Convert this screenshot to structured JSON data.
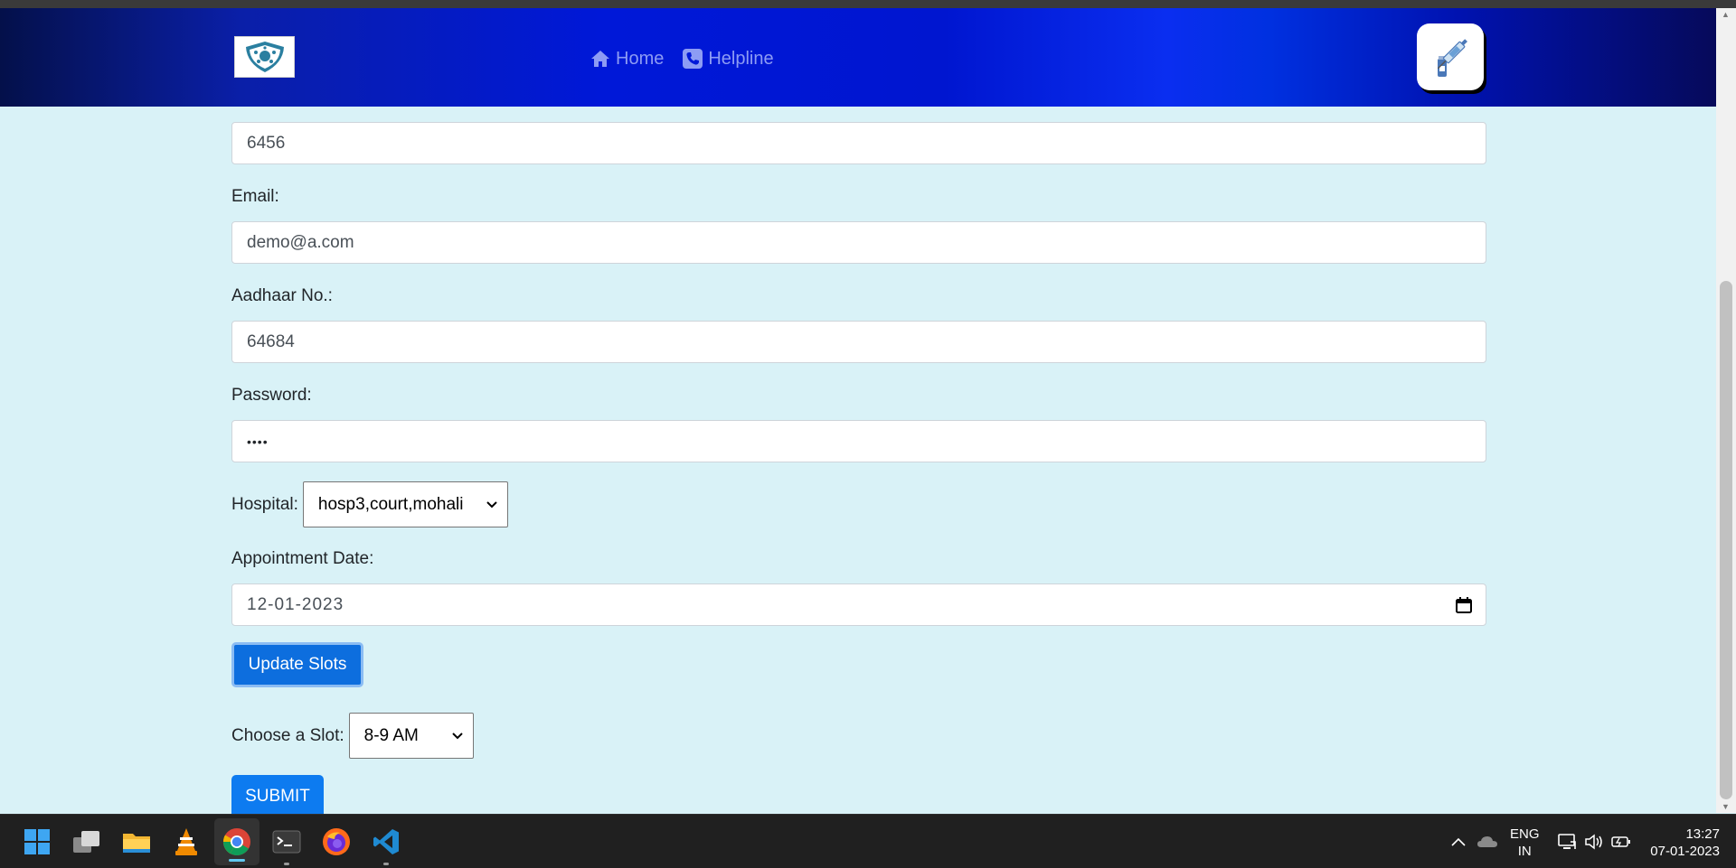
{
  "nav": {
    "home_label": "Home",
    "helpline_label": "Helpline"
  },
  "form": {
    "phone_value": "6456",
    "email_label": "Email:",
    "email_value": "demo@a.com",
    "aadhaar_label": "Aadhaar No.:",
    "aadhaar_value": "64684",
    "password_label": "Password:",
    "password_value": "••••",
    "hospital_label": "Hospital:",
    "hospital_selected": "hosp3,court,mohali",
    "date_label": "Appointment Date:",
    "date_value": "12-01-2023",
    "update_button": "Update Slots",
    "slot_label": "Choose a Slot:",
    "slot_selected": "8-9 AM",
    "submit_button": "SUBMIT"
  },
  "taskbar": {
    "lang_line1": "ENG",
    "lang_line2": "IN",
    "time": "13:27",
    "date": "07-01-2023",
    "apps": [
      "start-icon",
      "task-view-icon",
      "file-explorer-icon",
      "vlc-icon",
      "chrome-icon",
      "terminal-icon",
      "firefox-icon",
      "vscode-icon"
    ]
  },
  "colors": {
    "page_bg": "#d9f2f7",
    "header_blue": "#0018d8",
    "nav_text": "#8d9cf4",
    "button_blue": "#0d6ede"
  }
}
